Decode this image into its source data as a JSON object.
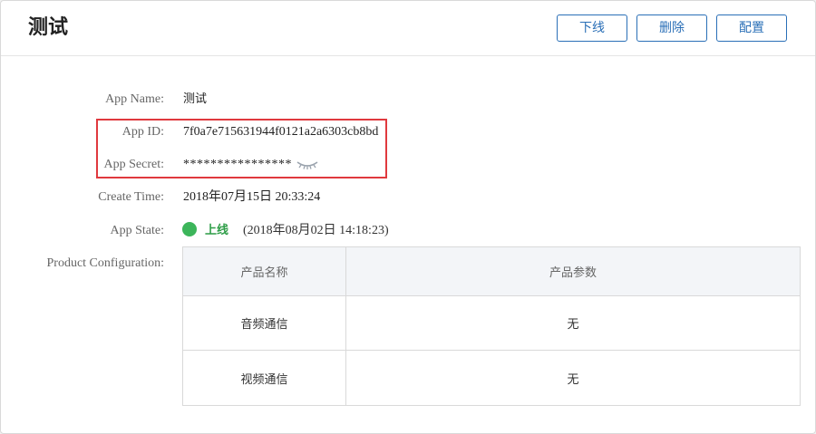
{
  "header": {
    "title": "测试",
    "buttons": {
      "offline": "下线",
      "delete": "删除",
      "config": "配置"
    }
  },
  "details": {
    "app_name_label": "App Name:",
    "app_name": "测试",
    "app_id_label": "App ID:",
    "app_id": "7f0a7e715631944f0121a2a6303cb8bd",
    "app_secret_label": "App Secret:",
    "app_secret": "****************",
    "create_time_label": "Create Time:",
    "create_time": "2018年07月15日 20:33:24",
    "app_state_label": "App State:",
    "app_state": "上线",
    "app_state_time": "(2018年08月02日 14:18:23)",
    "product_config_label": "Product Configuration:"
  },
  "table": {
    "headers": [
      "产品名称",
      "产品参数"
    ],
    "rows": [
      [
        "音频通信",
        "无"
      ],
      [
        "视频通信",
        "无"
      ]
    ]
  },
  "colors": {
    "accent": "#2a6fb7",
    "status_online": "#3cb55a",
    "highlight_border": "#e0393e"
  },
  "icons": {
    "secret_toggle": "eye-closed-icon",
    "status": "status-dot"
  }
}
